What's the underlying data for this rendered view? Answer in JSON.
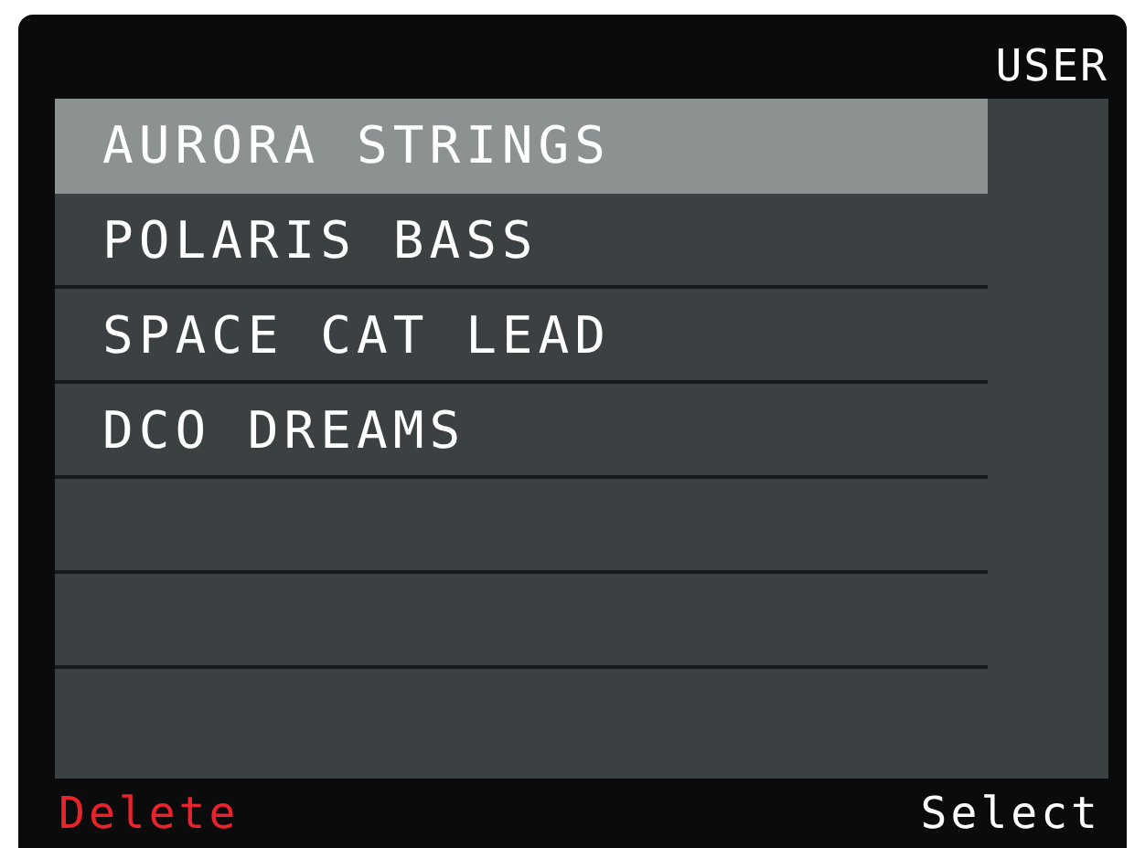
{
  "header": {
    "title": "USER"
  },
  "presets": [
    {
      "label": "AURORA STRINGS",
      "selected": true
    },
    {
      "label": "POLARIS BASS",
      "selected": false
    },
    {
      "label": "SPACE CAT LEAD",
      "selected": false
    },
    {
      "label": "DCO DREAMS",
      "selected": false
    }
  ],
  "softkeys": [
    {
      "label": "Delete",
      "kind": "danger"
    },
    {
      "label": "Select",
      "kind": "normal"
    }
  ]
}
